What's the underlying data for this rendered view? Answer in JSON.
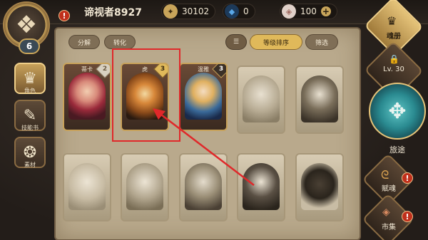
{
  "player": {
    "name": "谛视者8927",
    "level": "6",
    "avatar_icon": "emblem-icon"
  },
  "resources": [
    {
      "name": "gold-coin",
      "value": "30102",
      "color": "#c9a55a"
    },
    {
      "name": "blue-crystal",
      "value": "0",
      "color": "#5aa8e8"
    },
    {
      "name": "gem-stone",
      "value": "100",
      "color": "#d8a8a0"
    }
  ],
  "sidebar": {
    "items": [
      {
        "label": "角色",
        "icon": "character-icon",
        "active": true
      },
      {
        "label": "技能书",
        "icon": "skillbook-icon",
        "active": false
      },
      {
        "label": "素材",
        "icon": "material-icon",
        "active": false
      }
    ]
  },
  "tabs": {
    "decompose": "分解",
    "convert": "转化",
    "list_icon": "list-icon",
    "sort_by_level": "等级排序",
    "filter": "筛选"
  },
  "cards": [
    {
      "name": "蒂卡",
      "rank": "2",
      "owned": true,
      "rank_style": "grey"
    },
    {
      "name": "虎",
      "rank": "3",
      "owned": true,
      "rank_style": "gold"
    },
    {
      "name": "温雅",
      "rank": "3",
      "owned": true,
      "rank_style": "dark"
    },
    {
      "name": "",
      "rank": "",
      "owned": false
    },
    {
      "name": "",
      "rank": "",
      "owned": false
    },
    {
      "name": "",
      "rank": "",
      "owned": false
    },
    {
      "name": "",
      "rank": "",
      "owned": false
    },
    {
      "name": "",
      "rank": "",
      "owned": false
    },
    {
      "name": "",
      "rank": "",
      "owned": false
    },
    {
      "name": "",
      "rank": "",
      "owned": false
    }
  ],
  "right_panel": {
    "soul_album": "魂册",
    "lock_level": "Lv. 30",
    "journey": "旅途",
    "gift_soul": "赋魂",
    "market": "市集"
  },
  "colors": {
    "highlight_box": "#e0282a",
    "gold_accent": "#c9a55a"
  }
}
